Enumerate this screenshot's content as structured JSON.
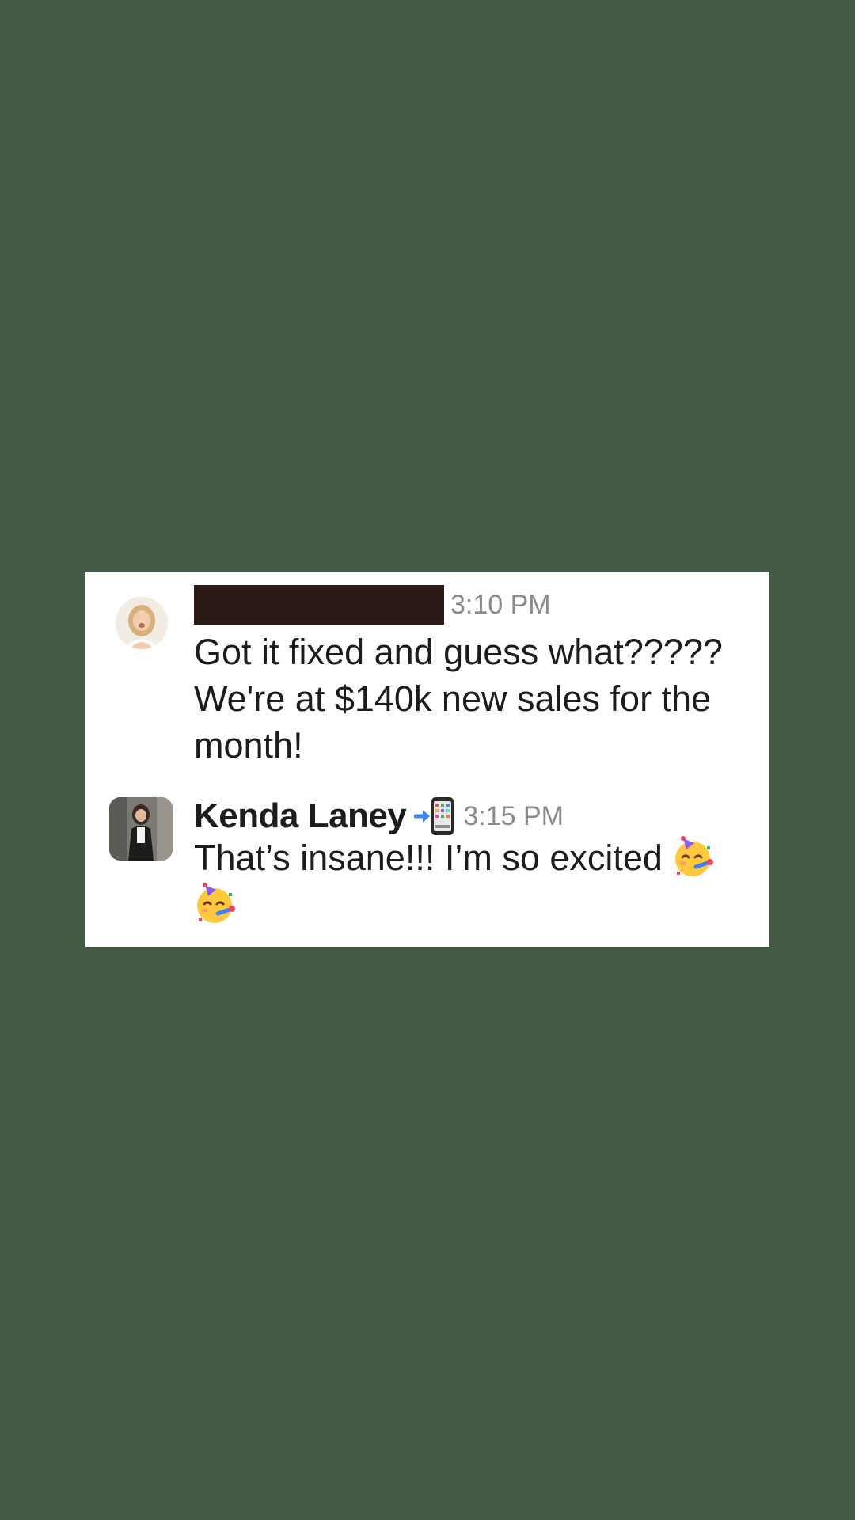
{
  "messages": [
    {
      "sender": "",
      "sender_redacted": true,
      "time": "3:10 PM",
      "text": "Got it fixed and guess what????? We're at $140k new sales for the month!",
      "avatar": "user-avatar"
    },
    {
      "sender": "Kenda Laney",
      "sender_redacted": false,
      "status_icon": "mobile-phone-arrow-icon",
      "time": "3:15 PM",
      "text": "That’s insane!!! I’m so excited",
      "emojis": [
        "partying-face-emoji",
        "partying-face-emoji"
      ],
      "avatar": "user-avatar"
    }
  ],
  "colors": {
    "background": "#435b45",
    "card": "#ffffff",
    "redaction": "#2b1915",
    "timestamp": "#8a8a8a",
    "text": "#1d1c1d"
  }
}
